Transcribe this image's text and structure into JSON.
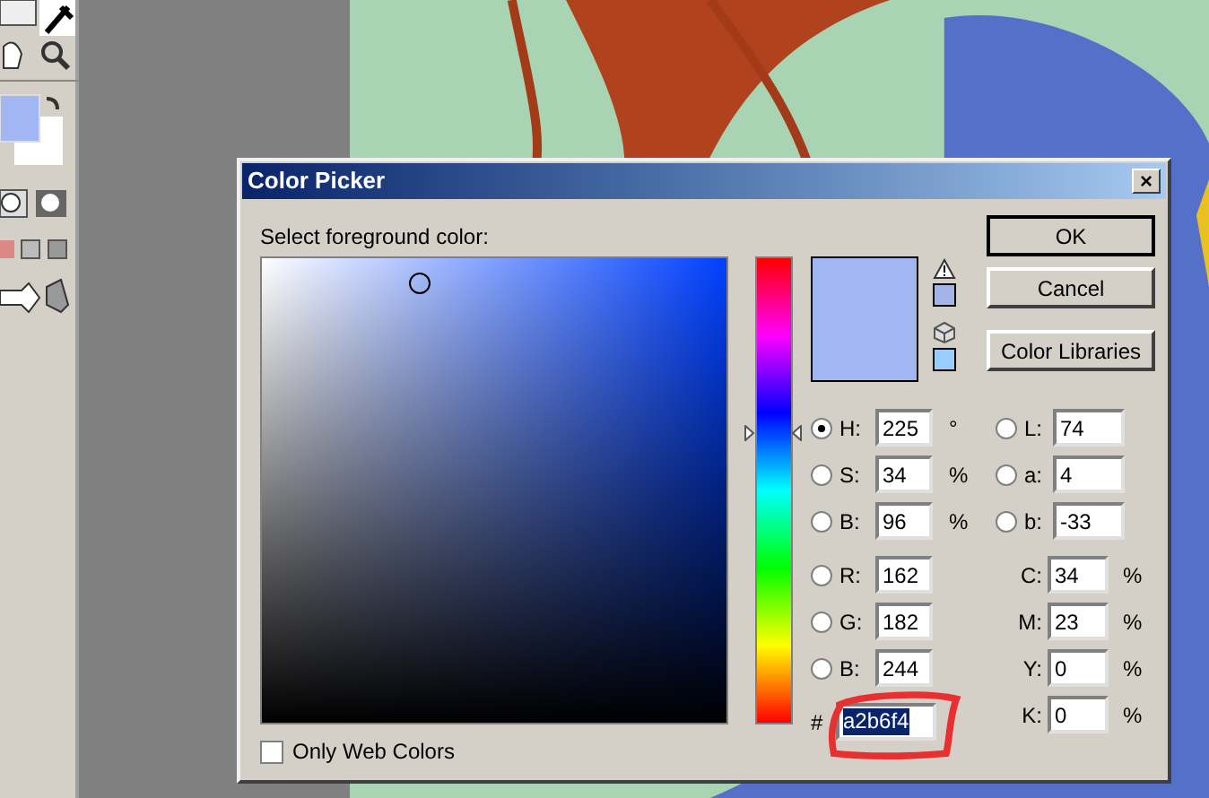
{
  "window": {
    "title": "Color Picker",
    "close": "×"
  },
  "prompt": "Select foreground color:",
  "hue_slider": {
    "level": 0.625
  },
  "buttons": [
    {
      "label": "OK",
      "default": true
    },
    {
      "label": "Cancel",
      "default": false
    },
    {
      "label": "Color Libraries",
      "default": false
    }
  ],
  "hsb": [
    {
      "label": "H:",
      "value": "225",
      "unit": "°",
      "selected": true
    },
    {
      "label": "S:",
      "value": "34",
      "unit": "%",
      "selected": false
    },
    {
      "label": "B:",
      "value": "96",
      "unit": "%",
      "selected": false
    }
  ],
  "lab": [
    {
      "label": "L:",
      "value": "74",
      "selected": false
    },
    {
      "label": "a:",
      "value": "4",
      "selected": false
    },
    {
      "label": "b:",
      "value": "-33",
      "selected": false
    }
  ],
  "rgb": [
    {
      "label": "R:",
      "value": "162",
      "selected": false
    },
    {
      "label": "G:",
      "value": "182",
      "selected": false
    },
    {
      "label": "B:",
      "value": "244",
      "selected": false
    }
  ],
  "cmyk": [
    {
      "label": "C:",
      "value": "34",
      "unit": "%"
    },
    {
      "label": "M:",
      "value": "23",
      "unit": "%"
    },
    {
      "label": "Y:",
      "value": "0",
      "unit": "%"
    },
    {
      "label": "K:",
      "value": "0",
      "unit": "%"
    }
  ],
  "hex": {
    "prefix": "#",
    "value": "a2b6f4"
  },
  "web_colors": {
    "label": "Only Web Colors",
    "checked": false
  }
}
